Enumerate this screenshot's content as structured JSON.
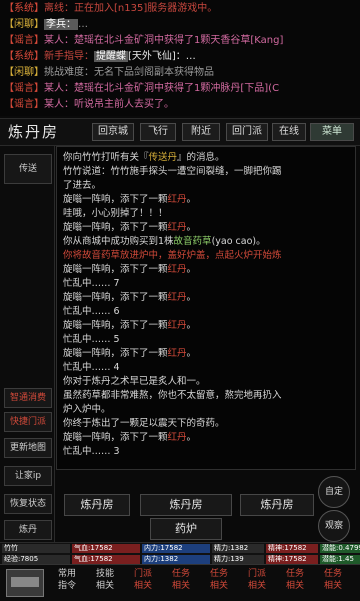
{
  "chat": {
    "lines": [
      {
        "tag": "【系统】",
        "text": "离线：正在加入[n135]服务器游戏中。"
      },
      {
        "tag": "【闲聊】",
        "name": "李兵：",
        "text": "…"
      },
      {
        "tag": "【谣言】",
        "text": "某人：楚瑶在北斗金矿洞中获得了1颗天香谷草[Kang]"
      },
      {
        "tag": "【系统】",
        "text": "新手指导：",
        "badge": "提醒蝶",
        "text2": "[天外飞仙]：…"
      },
      {
        "tag": "【闲聊】",
        "text": "挑战难度：无名下品剑阁副本获得物品"
      },
      {
        "tag": "【谣言】",
        "text": "某人：楚瑶在北斗金矿洞中获得了1颗冲脉丹[下品](C"
      },
      {
        "tag": "【谣言】",
        "text": "某人：听说吊主前人去买了。"
      }
    ]
  },
  "tabbar": {
    "title": "炼丹房",
    "tabs": [
      "回京城",
      "飞行",
      "附近",
      "回门派",
      "在线",
      "菜单"
    ]
  },
  "side": {
    "top_button": "传送",
    "buttons": [
      "智通消费",
      "快捷门派",
      "更新地图",
      "让家ip",
      "恢复状态",
      "炼丹"
    ]
  },
  "log": {
    "lines": [
      {
        "pre": "你向竹竹打听有关『",
        "acc": "传送丹",
        "post": "』的消息。"
      },
      {
        "text": "竹竹说道：竹竹施手探头一遭空间裂缝，一脚把你踢"
      },
      {
        "text": "了进去。"
      },
      {
        "text": "旋嗡一阵响，添下了一颗",
        "hot": "红丹",
        "post": "。"
      },
      {
        "text": "哇哦，小心别掉了！！！"
      },
      {
        "text": "旋嗡一阵响，添下了一颗",
        "hot": "红丹",
        "post": "。"
      },
      {
        "text": "你从商城中成功购买到1株",
        "herb": "故音药草",
        "post": "(yao cao)。"
      },
      {
        "hot": "你将故音药草放进炉中，盖好炉盖，点起火炉开始炼"
      },
      {
        "text": "旋嗡一阵响，添下了一颗",
        "hot": "红丹",
        "post": "。"
      },
      {
        "text": "忙乱中…… 7"
      },
      {
        "text": "旋嗡一阵响，添下了一颗",
        "hot": "红丹",
        "post": "。"
      },
      {
        "text": "忙乱中…… 6"
      },
      {
        "text": "旋嗡一阵响，添下了一颗",
        "hot": "红丹",
        "post": "。"
      },
      {
        "text": "忙乱中…… 5"
      },
      {
        "text": "旋嗡一阵响，添下了一颗",
        "hot": "红丹",
        "post": "。"
      },
      {
        "text": "忙乱中…… 4"
      },
      {
        "text": "你对于炼丹之术早已是炙人和一。"
      },
      {
        "text": "虽然药草都非常难熬，你也不太留意，熬完地再扔入"
      },
      {
        "text": "炉入炉中。"
      },
      {
        "text": "你终于炼出了一颗足以震天下的奇药。"
      },
      {
        "text": "旋嗡一阵响，添下了一颗",
        "hot": "红丹",
        "post": "。"
      },
      {
        "text": "忙乱中…… 3"
      }
    ]
  },
  "actions": {
    "row1": [
      "炼丹房",
      "炼丹房",
      "炼丹房"
    ],
    "row2": [
      "药炉"
    ],
    "auto": "自定",
    "view": "观察"
  },
  "status": {
    "row1": [
      "竹竹",
      "气血:17582",
      "内力:17582",
      "精力:1382",
      "精神:17582",
      "潜能:0.4799"
    ],
    "row2": [
      "经验:7805",
      "气血:17582",
      "内力:1382",
      "精力:139",
      "精神:17582",
      "潜能:1.45"
    ]
  },
  "bottom": {
    "nav": [
      {
        "a": "常用",
        "b": "指令"
      },
      {
        "a": "技能",
        "b": "相关"
      },
      {
        "a": "门派",
        "b": "相关"
      },
      {
        "a": "任务",
        "b": "相关"
      },
      {
        "a": "任务",
        "b": "相关"
      },
      {
        "a": "门派",
        "b": "相关"
      },
      {
        "a": "任务",
        "b": "相关"
      },
      {
        "a": "任务",
        "b": "相关"
      }
    ]
  }
}
